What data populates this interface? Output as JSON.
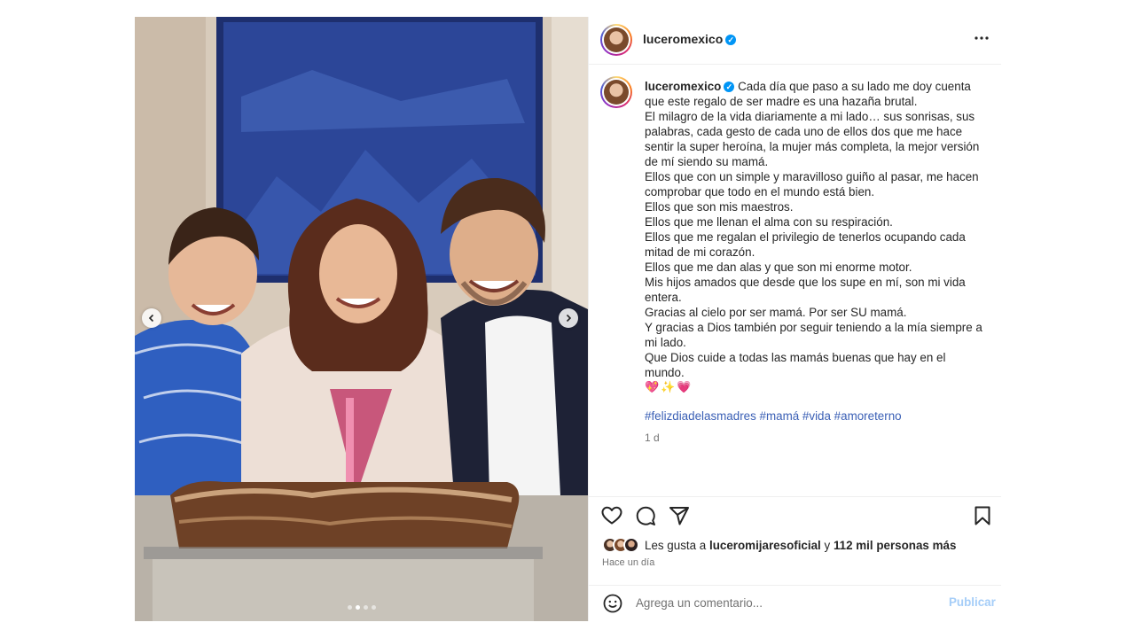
{
  "post": {
    "username": "luceromexico",
    "verified": true,
    "more_icon": "more-horizontal-icon"
  },
  "caption": {
    "lines": [
      "Cada día que paso a su lado me doy cuenta que este regalo de ser madre es una hazaña brutal.",
      "El milagro de la vida diariamente a mi lado… sus sonrisas, sus palabras, cada gesto de cada uno de ellos dos que me hace sentir la super heroína, la mujer más completa, la mejor versión de mí siendo su mamá.",
      "Ellos que con un simple y maravilloso guiño al pasar, me hacen comprobar que todo en el mundo está bien.",
      "Ellos que son mis maestros.",
      "Ellos que me llenan el alma con su respiración.",
      "Ellos que me regalan el privilegio de tenerlos ocupando cada mitad de mi corazón.",
      "Ellos que me dan alas y que son mi enorme motor.",
      "Mis hijos amados que desde que los supe en mí, son mi vida entera.",
      "Gracias al cielo por ser mamá. Por ser SU mamá.",
      "Y gracias a Dios también por seguir teniendo a la mía siempre a mi lado.",
      "Que Dios cuide a todas las mamás buenas que hay en el mundo."
    ],
    "emojis": "💖✨💗",
    "hashtags": [
      "#felizdiadelasmadres",
      "#mamá",
      "#vida",
      "#amoreterno"
    ],
    "time": "1 d"
  },
  "actions": {
    "like_icon": "heart-icon",
    "comment_icon": "comment-icon",
    "share_icon": "send-icon",
    "save_icon": "bookmark-icon"
  },
  "likes": {
    "prefix": "Les gusta a",
    "first_user": "luceromijaresoficial",
    "connector": "y",
    "others": "112 mil personas más"
  },
  "posted_ago": "Hace un día",
  "comment": {
    "placeholder": "Agrega un comentario...",
    "publish_label": "Publicar",
    "emoji_icon": "smiley-icon"
  },
  "carousel": {
    "slide_count": 4,
    "active_index": 1
  },
  "colors": {
    "verified": "#0095f6",
    "hashtag": "#3a5fb5",
    "publish": "#a5cdf8"
  }
}
